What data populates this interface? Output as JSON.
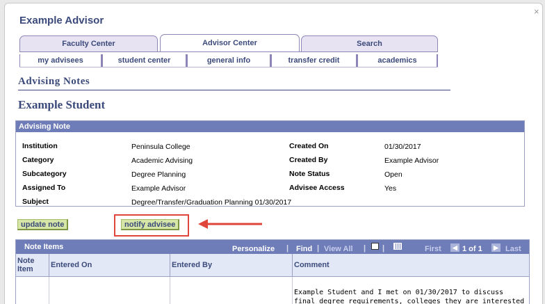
{
  "header": {
    "advisor_name": "Example Advisor"
  },
  "tabs": [
    {
      "label": "Faculty Center"
    },
    {
      "label": "Advisor Center"
    },
    {
      "label": "Search"
    }
  ],
  "subtabs": [
    {
      "label": "my advisees"
    },
    {
      "label": "student center"
    },
    {
      "label": "general info"
    },
    {
      "label": "transfer credit"
    },
    {
      "label": "academics"
    }
  ],
  "page": {
    "title": "Advising Notes",
    "student_name": "Example Student"
  },
  "note": {
    "header": "Advising Note",
    "fields": {
      "institution_label": "Institution",
      "institution": "Peninsula College",
      "category_label": "Category",
      "category": "Academic Advising",
      "subcategory_label": "Subcategory",
      "subcategory": "Degree Planning",
      "assigned_label": "Assigned To",
      "assigned": "Example Advisor",
      "subject_label": "Subject",
      "subject": "Degree/Transfer/Graduation Planning 01/30/2017",
      "created_on_label": "Created On",
      "created_on": "01/30/2017",
      "created_by_label": "Created By",
      "created_by": "Example Advisor",
      "status_label": "Note Status",
      "status": "Open",
      "access_label": "Advisee Access",
      "access": "Yes"
    }
  },
  "buttons": {
    "update": "update note",
    "notify": "notify advisee"
  },
  "items": {
    "header": "Note Items",
    "personalize": "Personalize",
    "find": "Find",
    "view_all": "View All",
    "first": "First",
    "range": "1 of 1",
    "last": "Last",
    "columns": [
      "Note Item",
      "Entered On",
      "Entered By",
      "Comment"
    ],
    "comment_line1": "Example Student and I met on 01/30/2017 to discuss",
    "comment_line2": "final degree requirements, colleges they are interested"
  },
  "colors": {
    "accent": "#3b4a7a",
    "header_bar": "#6e7db8",
    "button": "#d5e6a6",
    "highlight": "#e0453a"
  }
}
